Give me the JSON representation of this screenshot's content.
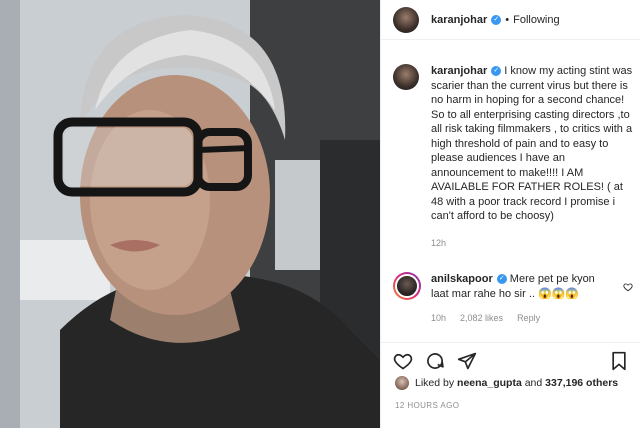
{
  "post": {
    "author": "karanjohar",
    "follow_status": "Following",
    "separator": "•"
  },
  "caption": {
    "username": "karanjohar",
    "text": " I know my acting stint was scarier than the current virus but there is no harm in hoping for a second chance! So to all enterprising casting directors ,to all risk taking filmmakers , to critics with a high threshold of pain and to easy to please audiences I have an announcement to make!!!! I AM AVAILABLE FOR FATHER ROLES! ( at 48 with a poor track record I promise i can't afford to be choosy)",
    "time": "12h"
  },
  "comment": {
    "username": "anilskapoor",
    "text": " Mere pet pe kyon laat mar rahe ho sir .. 😱😱😱",
    "time": "10h",
    "likes": "2,082 likes",
    "reply_label": "Reply"
  },
  "likes": {
    "prefix": "Liked by",
    "first_user": "neena_gupta",
    "conjunction": "and",
    "others": "337,196 others"
  },
  "timestamp": "12 HOURS AGO",
  "icons": {
    "verified": "✓",
    "like": "heart-icon",
    "comment": "comment-icon",
    "share": "share-icon",
    "save": "bookmark-icon"
  },
  "colors": {
    "verified_blue": "#3897f0",
    "muted": "#8e8e8e",
    "text": "#262626"
  }
}
